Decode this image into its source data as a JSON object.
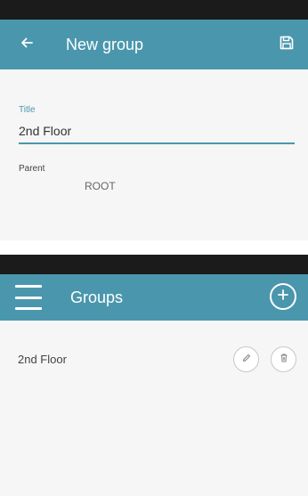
{
  "new_group_screen": {
    "title": "New group",
    "back_icon": "arrow-left-icon",
    "save_icon": "floppy-disk-icon",
    "form": {
      "title_label": "Title",
      "title_value": "2nd Floor",
      "parent_label": "Parent",
      "parent_value": "ROOT"
    }
  },
  "groups_screen": {
    "title": "Groups",
    "menu_icon": "hamburger-menu-icon",
    "add_icon": "plus-circle-icon",
    "items": [
      {
        "label": "2nd Floor",
        "edit_icon": "pencil-icon",
        "delete_icon": "trash-icon"
      }
    ]
  },
  "colors": {
    "app_bar": "#4a97ad",
    "status_bar": "#1b1b1b",
    "background": "#f6f6f6",
    "accent": "#4a97ad"
  }
}
